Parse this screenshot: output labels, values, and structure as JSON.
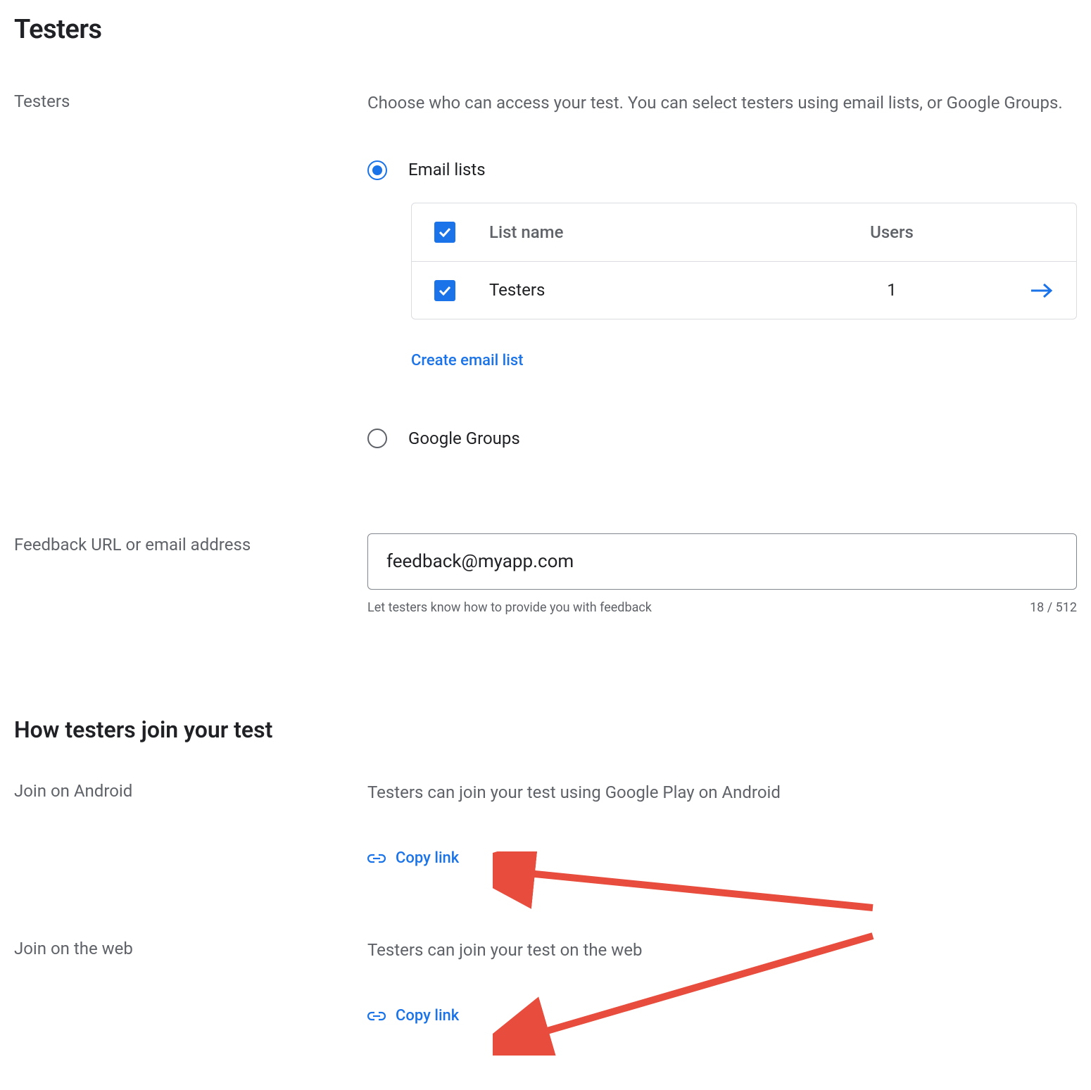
{
  "section1": {
    "heading": "Testers",
    "rowLabel": "Testers",
    "description": "Choose who can access your test. You can select testers using email lists, or Google Groups.",
    "emailListsLabel": "Email lists",
    "googleGroupsLabel": "Google Groups",
    "table": {
      "header": {
        "listName": "List name",
        "users": "Users"
      },
      "rows": [
        {
          "name": "Testers",
          "users": "1"
        }
      ]
    },
    "createListLabel": "Create email list"
  },
  "feedback": {
    "rowLabel": "Feedback URL or email address",
    "value": "feedback@myapp.com",
    "helper": "Let testers know how to provide you with feedback",
    "counter": "18 / 512"
  },
  "section2": {
    "heading": "How testers join your test",
    "android": {
      "label": "Join on Android",
      "desc": "Testers can join your test using Google Play on Android",
      "copy": "Copy link"
    },
    "web": {
      "label": "Join on the web",
      "desc": "Testers can join your test on the web",
      "copy": "Copy link"
    }
  }
}
